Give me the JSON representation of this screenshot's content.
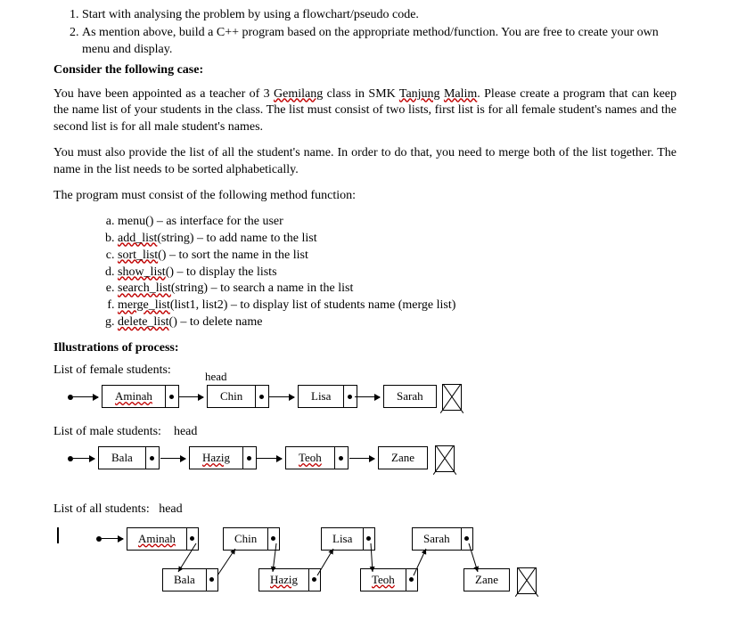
{
  "top_instructions": [
    "Start with analysing the problem by using a flowchart/pseudo code.",
    "As mention above, build a C++ program based on the appropriate method/function. You are free to create your own menu and display."
  ],
  "consider_heading": "Consider the following case:",
  "para1_a": "You have been appointed as a teacher of 3 ",
  "para1_gemilang": "Gemilang",
  "para1_b": " class in SMK ",
  "para1_tanjung": "Tanjung",
  "para1_c": " ",
  "para1_malim": "Malim",
  "para1_d": ". Please create a program that can keep the name list of your students in the class. The list must consist of two lists, first list is for all female student's names and the second list is for all male student's names.",
  "para2": "You must also provide the list of all the student's name. In order to do that, you need to merge both of the list together. The name in the list needs to be sorted alphabetically.",
  "para3": "The program must consist of the following method function:",
  "methods": {
    "a_pre": "menu() – as interface for the user",
    "b_fn": "add_list",
    "b_post": "(string) – to add name to the list",
    "c_fn": "sort_list",
    "c_post": "() – to sort the name in the list",
    "d_fn": "show_list",
    "d_post": "() – to display the lists",
    "e_fn": "search_list",
    "e_post": "(string) – to search a name in the list",
    "f_fn": "merge_list",
    "f_post": "(list1, list2) – to display list of students name (merge list)",
    "g_fn": "delete_list",
    "g_post": "() – to delete name"
  },
  "illustrations": "Illustrations of process:",
  "female_label": "List of female students:",
  "male_label": "List of male students:",
  "all_label": "List of all students:",
  "head_word": "head",
  "nodes": {
    "aminah": "Aminah",
    "chin": "Chin",
    "lisa": "Lisa",
    "sarah": "Sarah",
    "bala": "Bala",
    "hazig": "Hazig",
    "teoh": "Teoh",
    "zane": "Zane"
  }
}
